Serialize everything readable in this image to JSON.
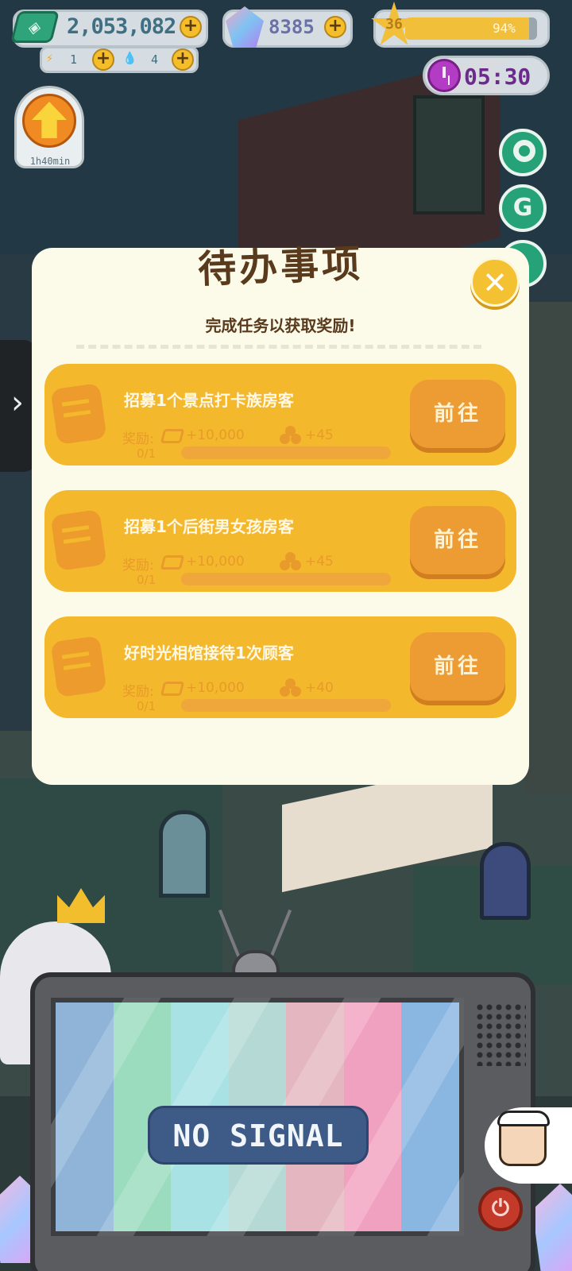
{
  "hud": {
    "cash": "2,053,082",
    "energy": "1",
    "water": "4",
    "gems": "8385",
    "level": "36",
    "level_progress_label": "94%",
    "level_progress": 0.94,
    "timer": "05:30"
  },
  "upgrade": {
    "time_label": "1h40min"
  },
  "modal": {
    "title": "待办事项",
    "subtitle": "完成任务以获取奖励!",
    "close_icon": "close-icon"
  },
  "tasks": [
    {
      "title": "招募1个景点打卡族房客",
      "reward_label": "奖励:",
      "cash_reward": "+10,000",
      "heart_reward": "+45",
      "progress_label": "0/1",
      "progress": 0,
      "button_label": "前往"
    },
    {
      "title": "招募1个后街男女孩房客",
      "reward_label": "奖励:",
      "cash_reward": "+10,000",
      "heart_reward": "+45",
      "progress_label": "0/1",
      "progress": 0,
      "button_label": "前往"
    },
    {
      "title": "好时光相馆接待1次顾客",
      "reward_label": "奖励:",
      "cash_reward": "+10,000",
      "heart_reward": "+40",
      "progress_label": "0/1",
      "progress": 0,
      "button_label": "前往"
    }
  ],
  "tv": {
    "message": "NO SIGNAL",
    "bar_colors": [
      "#8fb4d8",
      "#9bdcbe",
      "#a9e2e4",
      "#b5d9d4",
      "#e4b7c0",
      "#f1a1c0",
      "#8ab6e2"
    ]
  },
  "colors": {
    "modal_bg": "#fcfbea",
    "task_bg": "#f4b82c",
    "go_button": "#ed9b33",
    "side_button": "#25a277",
    "timer": "#b23cc4"
  }
}
